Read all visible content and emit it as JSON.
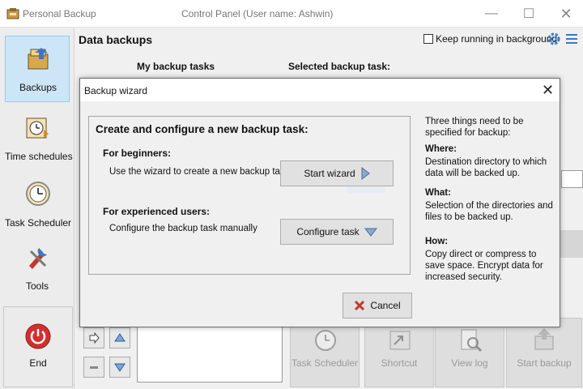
{
  "window": {
    "app_title": "Personal Backup",
    "control_title": "Control Panel (User name: Ashwin)",
    "minimize_glyph": "—",
    "maximize_glyph": "☐",
    "close_glyph": "✕"
  },
  "sidebar": {
    "items": [
      {
        "label": "Backups",
        "icon": "backups-icon",
        "active": true
      },
      {
        "label": "Time schedules",
        "icon": "time-schedules-icon",
        "active": false
      },
      {
        "label": "Task Scheduler",
        "icon": "task-scheduler-icon",
        "active": false
      },
      {
        "label": "Tools",
        "icon": "tools-icon",
        "active": false
      }
    ],
    "end_label": "End"
  },
  "main": {
    "title": "Data backups",
    "keep_running_label": "Keep running in background",
    "keep_running_checked": false,
    "my_tasks_header": "My backup tasks",
    "selected_task_header": "Selected backup task:"
  },
  "bottom_buttons": [
    {
      "label": "Task Scheduler",
      "icon": "task-scheduler-icon"
    },
    {
      "label": "Shortcut",
      "icon": "shortcut-icon"
    },
    {
      "label": "View log",
      "icon": "view-log-icon"
    },
    {
      "label": "Start backup",
      "icon": "start-backup-icon"
    }
  ],
  "dialog": {
    "title": "Backup wizard",
    "close_glyph": "✕",
    "heading": "Create and configure a new backup task:",
    "beginners_head": "For beginners:",
    "beginners_text": "Use the wizard to create a new backup task",
    "start_wizard_label": "Start wizard",
    "experienced_head": "For experienced users:",
    "experienced_text": "Configure the backup task manually",
    "configure_label": "Configure task",
    "cancel_label": "Cancel",
    "help": {
      "intro": "Three things need to be specified for backup:",
      "where_head": "Where:",
      "where_text": "Destination directory to which data will be backed up.",
      "what_head": "What:",
      "what_text": "Selection of the directories and files to be backed up.",
      "how_head": "How:",
      "how_text": "Copy direct or compress to save space. Encrypt data for increased security."
    }
  },
  "colors": {
    "accent": "#3a78c4",
    "active_nav": "#cde6f7",
    "cancel_red": "#c0392b",
    "end_red": "#d32f2f"
  }
}
